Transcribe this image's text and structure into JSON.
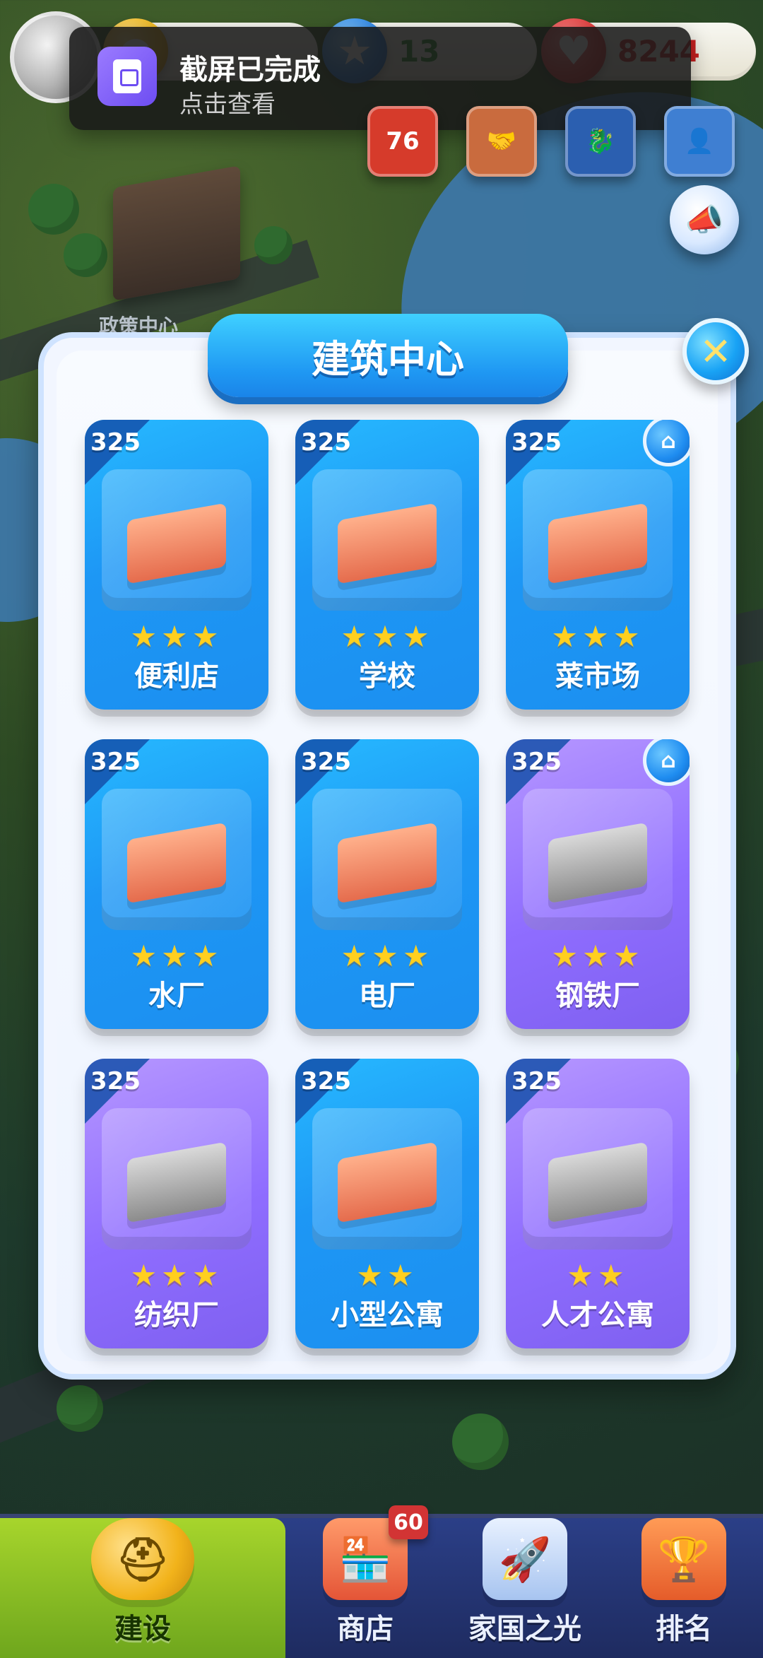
{
  "status_bar": {
    "resources": [
      {
        "id": "gold",
        "icon": "coin-icon",
        "value": "",
        "color": "#f1b81a"
      },
      {
        "id": "gems",
        "icon": "gem-icon",
        "value": "13",
        "color": "#2e86e8"
      },
      {
        "id": "health",
        "icon": "heart-icon",
        "value": "8244",
        "color": "#e43b3b"
      }
    ],
    "event_buttons": [
      {
        "icon": "event-76-icon",
        "label": "76",
        "color": "#d63b2b"
      },
      {
        "icon": "handshake-icon",
        "label": "",
        "color": "#c96b3e"
      },
      {
        "icon": "dragon-icon",
        "label": "",
        "color": "#2b5fb0"
      },
      {
        "icon": "person-icon",
        "label": "",
        "color": "#3f7fd2"
      }
    ],
    "megaphone_icon": "megaphone-icon"
  },
  "notification": {
    "title": "截屏已完成",
    "subtitle": "点击查看",
    "icon": "screenshot-icon"
  },
  "map": {
    "policy_center_label": "政策中心"
  },
  "dialog": {
    "title": "建筑中心",
    "close_icon": "close-icon",
    "cards": [
      {
        "cost": "325",
        "name": "便利店",
        "stars": "★★★",
        "style": "blue",
        "home_icon": false
      },
      {
        "cost": "325",
        "name": "学校",
        "stars": "★★★",
        "style": "blue",
        "home_icon": false
      },
      {
        "cost": "325",
        "name": "菜市场",
        "stars": "★★★",
        "style": "blue",
        "home_icon": true
      },
      {
        "cost": "325",
        "name": "水厂",
        "stars": "★★★",
        "style": "blue",
        "home_icon": false
      },
      {
        "cost": "325",
        "name": "电厂",
        "stars": "★★★",
        "style": "blue",
        "home_icon": false
      },
      {
        "cost": "325",
        "name": "钢铁厂",
        "stars": "★★★",
        "style": "purple",
        "home_icon": true
      },
      {
        "cost": "325",
        "name": "纺织厂",
        "stars": "★★★",
        "style": "purple",
        "home_icon": false
      },
      {
        "cost": "325",
        "name": "小型公寓",
        "stars": "★★",
        "style": "blue",
        "home_icon": false
      },
      {
        "cost": "325",
        "name": "人才公寓",
        "stars": "★★",
        "style": "purple",
        "home_icon": false
      }
    ]
  },
  "bottom_nav": {
    "items": [
      {
        "label": "建设",
        "icon": "hardhat-icon"
      },
      {
        "label": "商店",
        "icon": "shop-icon",
        "badge": "60"
      },
      {
        "label": "家国之光",
        "icon": "rocket-icon"
      },
      {
        "label": "排名",
        "icon": "ranking-icon"
      }
    ]
  }
}
